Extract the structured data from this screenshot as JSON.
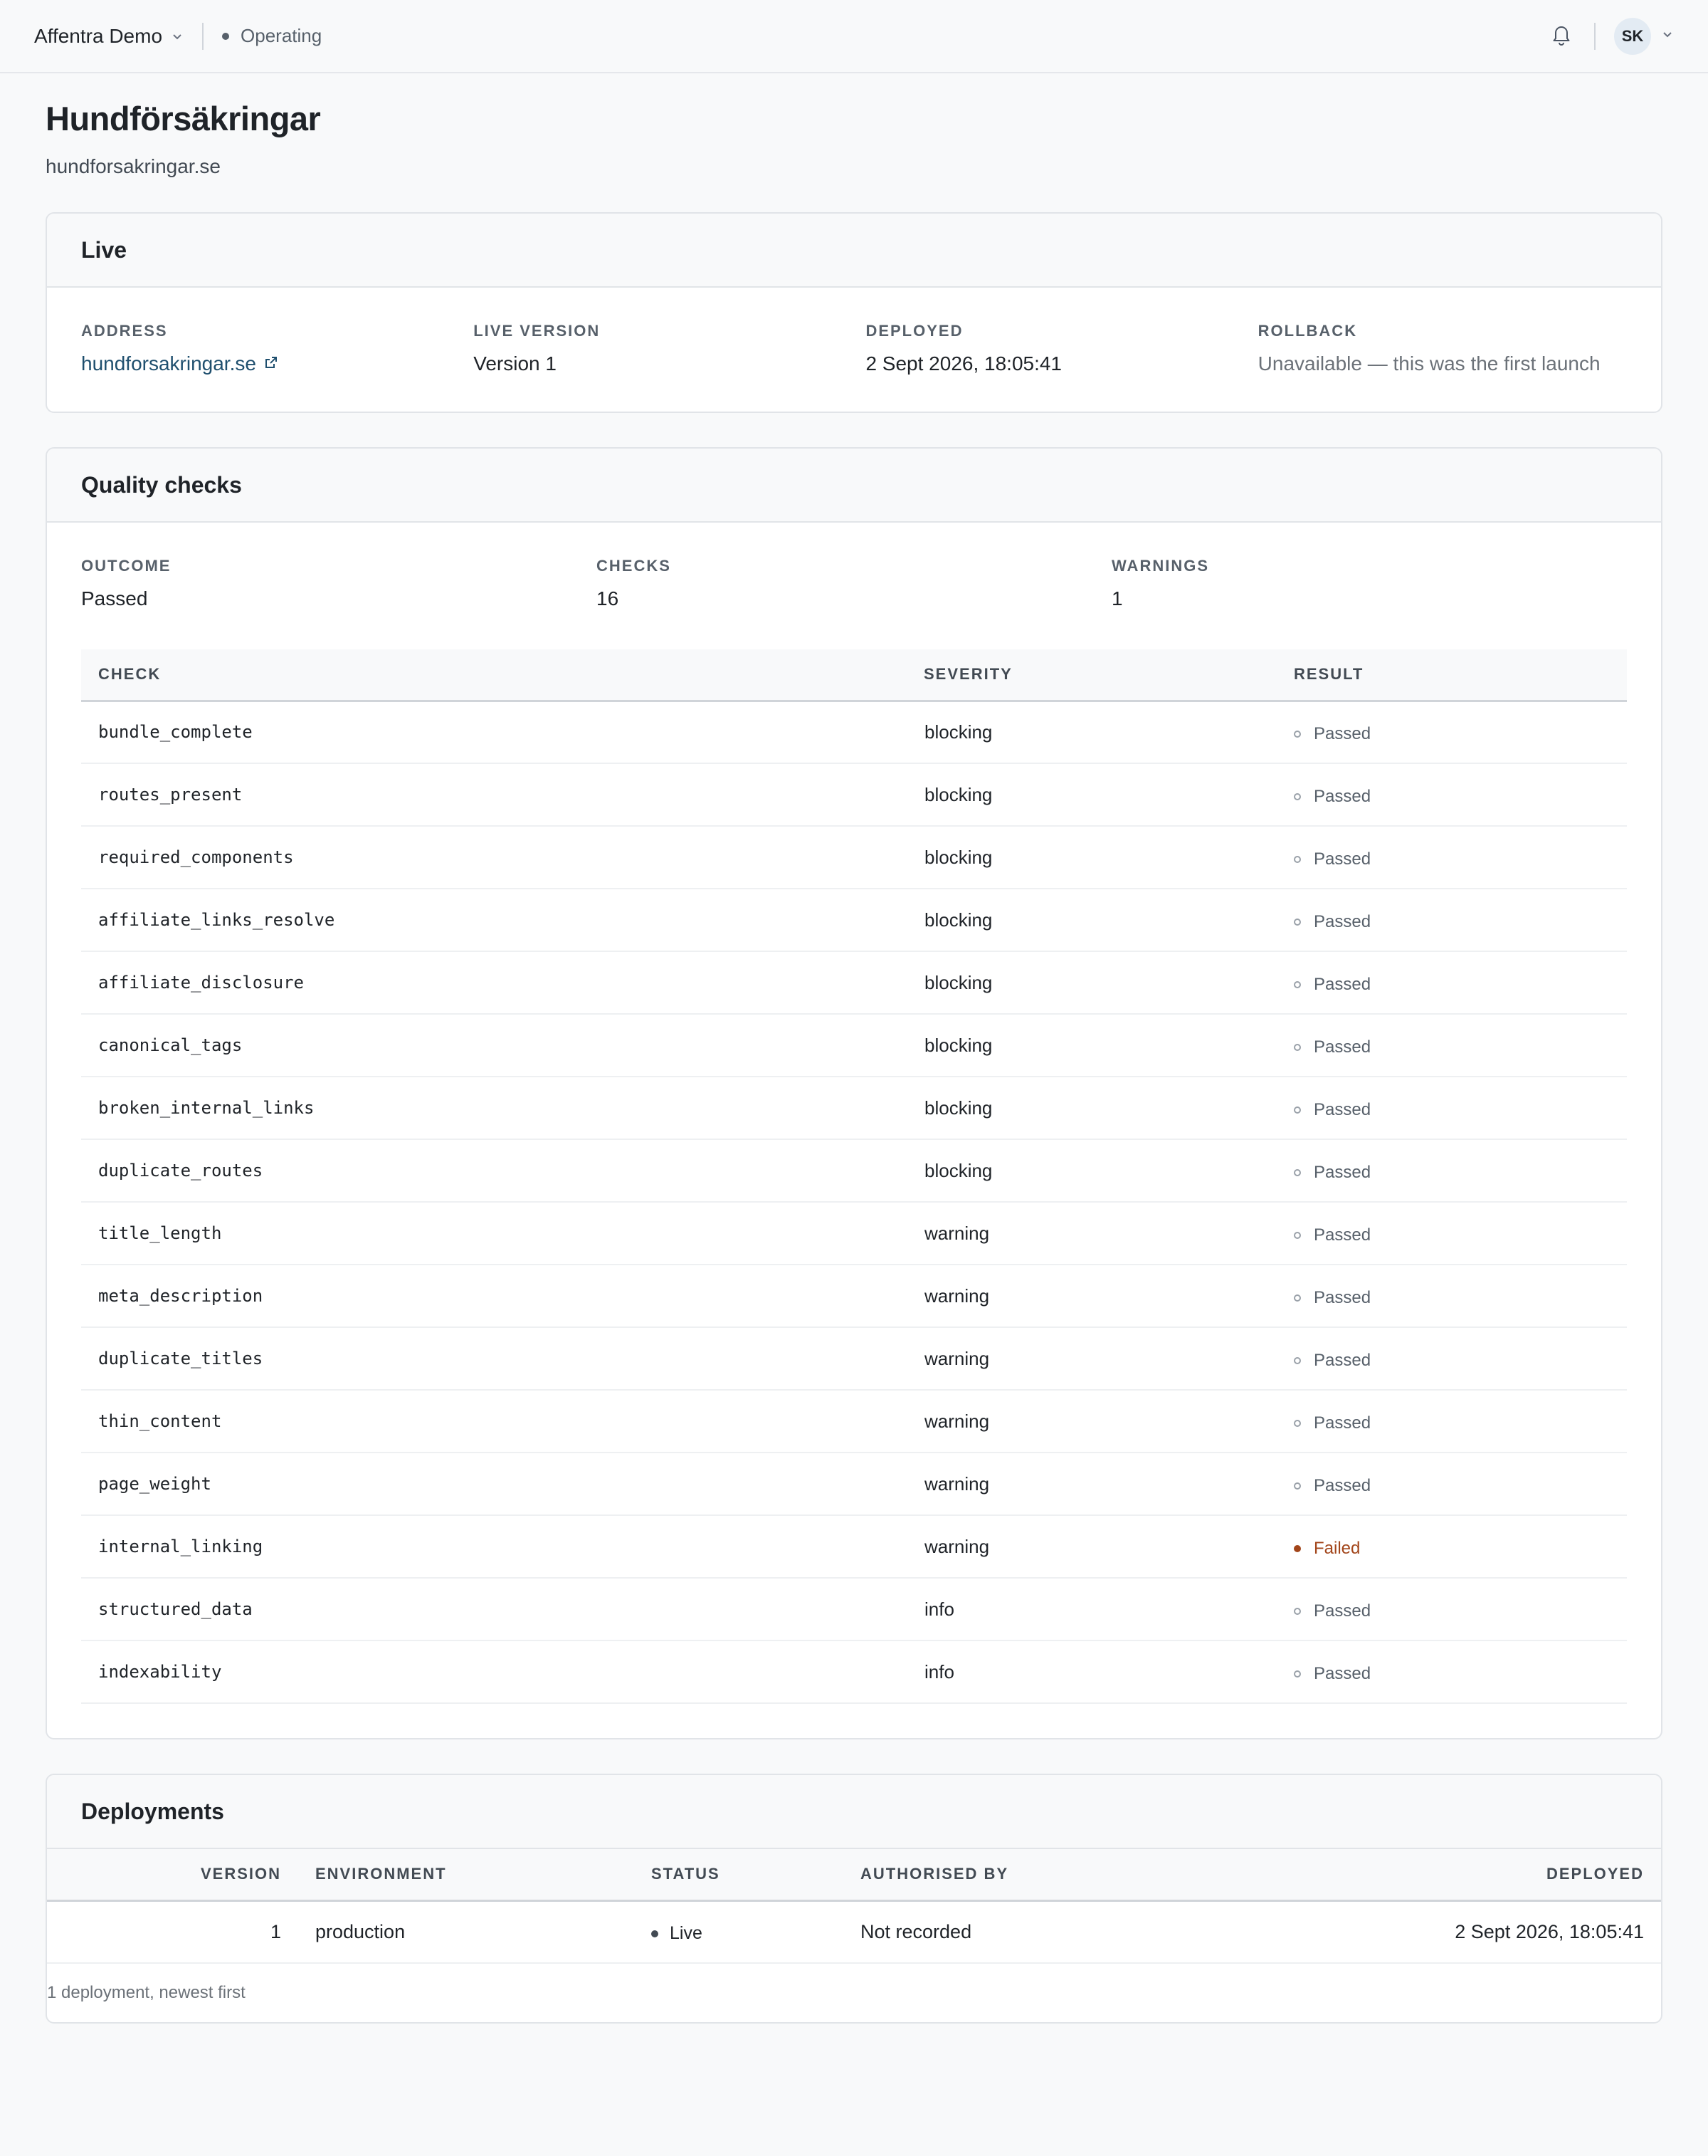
{
  "header": {
    "workspace": "Affentra Demo",
    "status": "Operating",
    "avatar_initials": "SK"
  },
  "page": {
    "title": "Hundförsäkringar",
    "subtitle": "hundforsakringar.se"
  },
  "live": {
    "title": "Live",
    "address_label": "ADDRESS",
    "address_value": "hundforsakringar.se",
    "version_label": "LIVE VERSION",
    "version_value": "Version 1",
    "deployed_label": "DEPLOYED",
    "deployed_value": "2 Sept 2026, 18:05:41",
    "rollback_label": "ROLLBACK",
    "rollback_value": "Unavailable — this was the first launch"
  },
  "quality": {
    "title": "Quality checks",
    "outcome_label": "OUTCOME",
    "outcome_value": "Passed",
    "checks_label": "CHECKS",
    "checks_value": "16",
    "warnings_label": "WARNINGS",
    "warnings_value": "1",
    "columns": [
      "CHECK",
      "SEVERITY",
      "RESULT"
    ],
    "rows": [
      {
        "check": "bundle_complete",
        "severity": "blocking",
        "result": "Passed"
      },
      {
        "check": "routes_present",
        "severity": "blocking",
        "result": "Passed"
      },
      {
        "check": "required_components",
        "severity": "blocking",
        "result": "Passed"
      },
      {
        "check": "affiliate_links_resolve",
        "severity": "blocking",
        "result": "Passed"
      },
      {
        "check": "affiliate_disclosure",
        "severity": "blocking",
        "result": "Passed"
      },
      {
        "check": "canonical_tags",
        "severity": "blocking",
        "result": "Passed"
      },
      {
        "check": "broken_internal_links",
        "severity": "blocking",
        "result": "Passed"
      },
      {
        "check": "duplicate_routes",
        "severity": "blocking",
        "result": "Passed"
      },
      {
        "check": "title_length",
        "severity": "warning",
        "result": "Passed"
      },
      {
        "check": "meta_description",
        "severity": "warning",
        "result": "Passed"
      },
      {
        "check": "duplicate_titles",
        "severity": "warning",
        "result": "Passed"
      },
      {
        "check": "thin_content",
        "severity": "warning",
        "result": "Passed"
      },
      {
        "check": "page_weight",
        "severity": "warning",
        "result": "Passed"
      },
      {
        "check": "internal_linking",
        "severity": "warning",
        "result": "Failed"
      },
      {
        "check": "structured_data",
        "severity": "info",
        "result": "Passed"
      },
      {
        "check": "indexability",
        "severity": "info",
        "result": "Passed"
      }
    ]
  },
  "deployments": {
    "title": "Deployments",
    "columns": [
      "VERSION",
      "ENVIRONMENT",
      "STATUS",
      "AUTHORISED BY",
      "DEPLOYED"
    ],
    "rows": [
      {
        "version": "1",
        "environment": "production",
        "status": "Live",
        "authorised_by": "Not recorded",
        "deployed": "2 Sept 2026, 18:05:41"
      }
    ],
    "footer": "1 deployment, newest first"
  },
  "colors": {
    "failed": "#a2451a",
    "link": "#1f4f6e"
  }
}
